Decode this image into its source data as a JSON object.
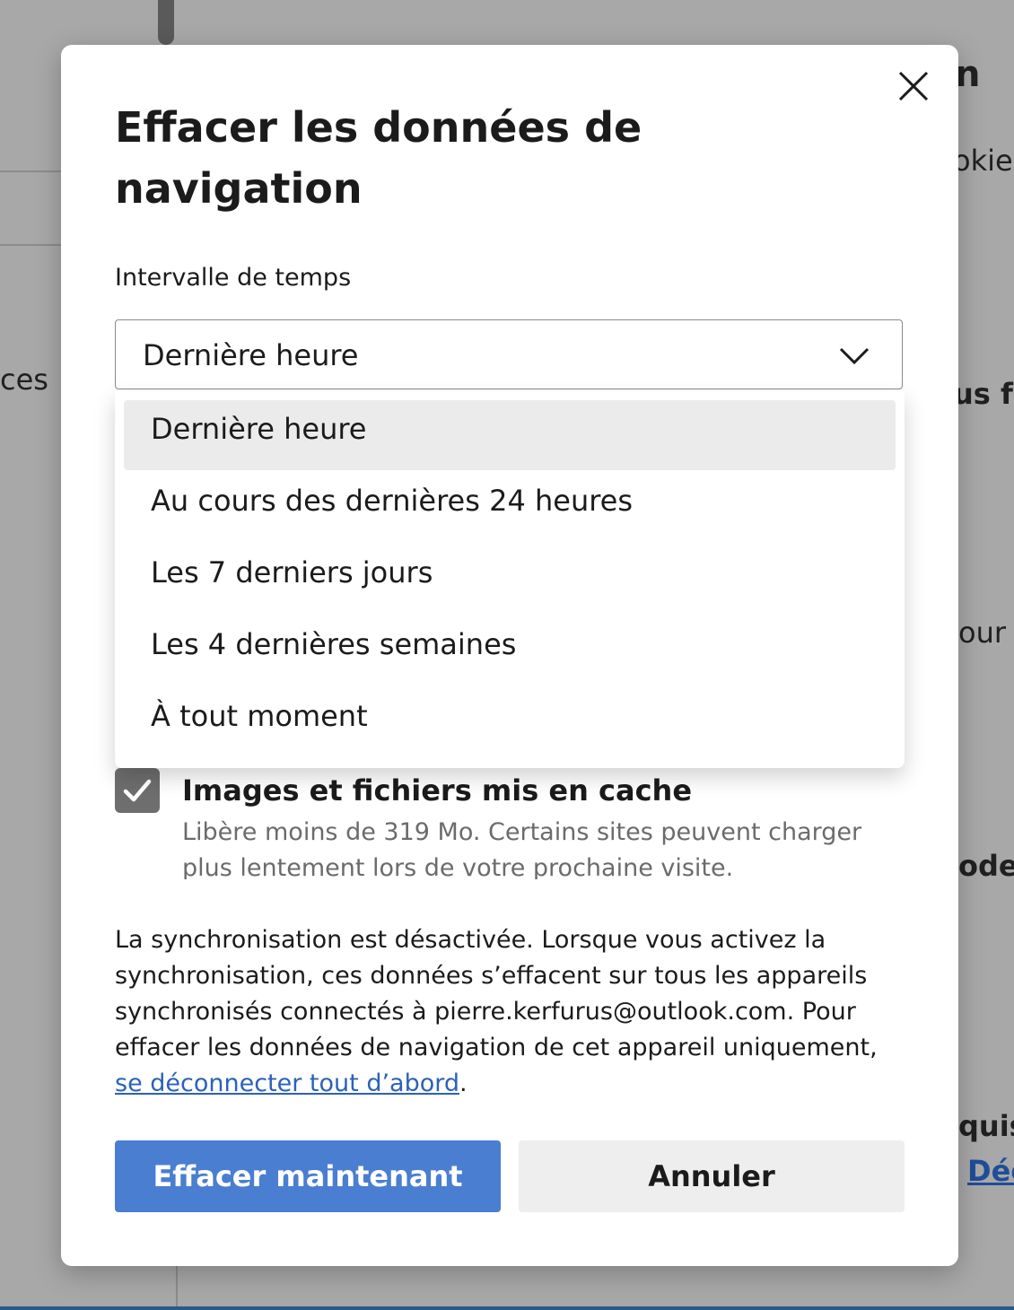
{
  "background": {
    "fragments": [
      "n",
      "okies",
      "ces",
      "us fe",
      "our",
      "odes",
      "quis"
    ],
    "link": "Déc"
  },
  "dialog": {
    "title": "Effacer les données de navigation",
    "time_range_label": "Intervalle de temps",
    "time_range_selected": "Dernière heure",
    "time_range_options": [
      "Dernière heure",
      "Au cours des dernières 24 heures",
      "Les 7 derniers jours",
      "Les 4 dernières semaines",
      "À tout moment"
    ],
    "cache": {
      "label": "Images et fichiers mis en cache",
      "description": "Libère moins de 319 Mo. Certains sites peuvent charger plus lentement lors de votre prochaine visite.",
      "checked": true
    },
    "sync_notice": {
      "text": "La synchronisation est désactivée. Lorsque vous activez la synchronisation, ces données s’effacent sur tous les appareils synchronisés connectés à pierre.kerfurus@outlook.com. Pour effacer les données de navigation de cet appareil uniquement, ",
      "link": "se déconnecter tout d’abord",
      "suffix": "."
    },
    "buttons": {
      "clear": "Effacer maintenant",
      "cancel": "Annuler"
    }
  },
  "colors": {
    "primary": "#4a7ed0",
    "link": "#2b62b8",
    "backdrop": "#a8a8a8"
  },
  "icons": {
    "close": "close-icon",
    "chevron": "chevron-down-icon",
    "check": "checkmark-icon"
  }
}
